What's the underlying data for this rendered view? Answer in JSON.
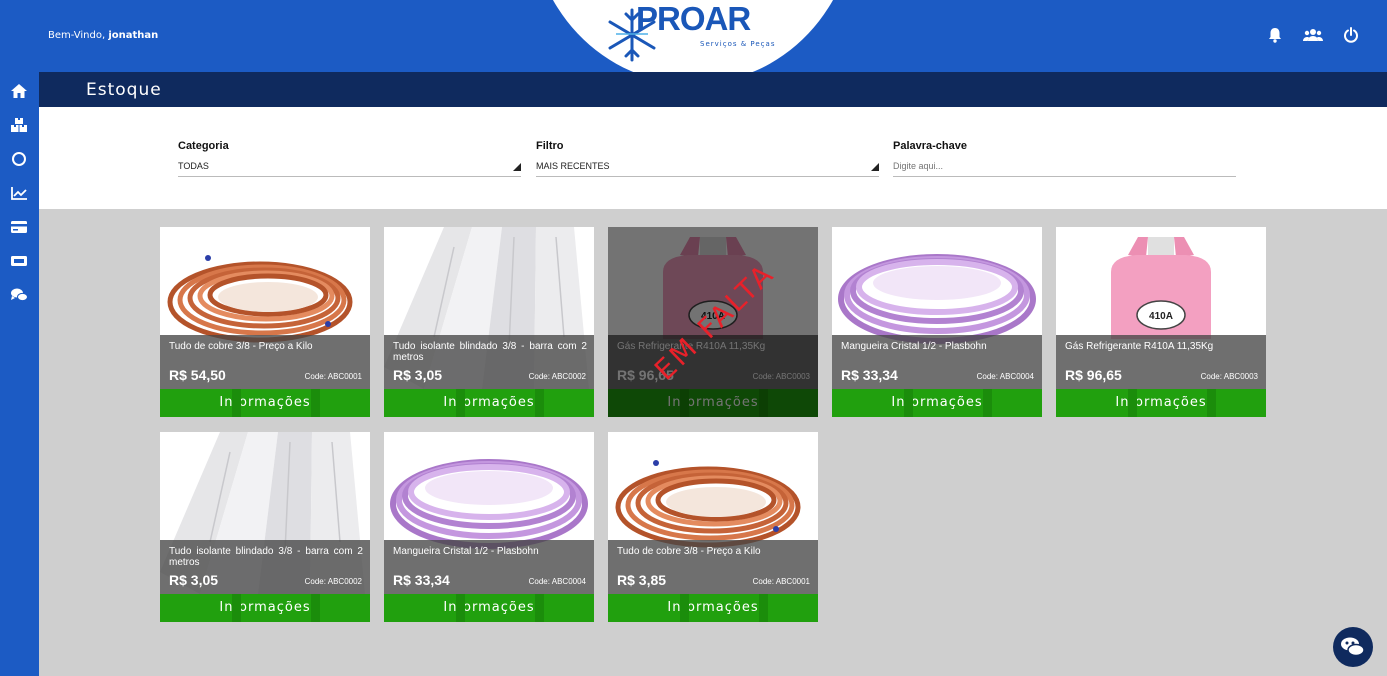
{
  "header": {
    "welcome_prefix": "Bem-Vindo,",
    "user_name": "jonathan",
    "logo_text": "PROAR",
    "logo_subtitle": "Serviços & Peças",
    "icons": [
      "bell-icon",
      "users-icon",
      "power-icon"
    ]
  },
  "sidebar": {
    "icons": [
      "home-icon",
      "boxes-icon",
      "circle-icon",
      "chart-icon",
      "card-icon",
      "ticket-icon",
      "chat-icon"
    ]
  },
  "page": {
    "title": "Estoque"
  },
  "filters": {
    "categoria": {
      "label": "Categoria",
      "value": "TODAS"
    },
    "filtro": {
      "label": "Filtro",
      "value": "MAIS RECENTES"
    },
    "palavra": {
      "label": "Palavra-chave",
      "placeholder": "Digite aqui..."
    }
  },
  "products": [
    {
      "name": "Tudo de cobre 3/8 - Preço a Kilo",
      "price": "R$ 54,50",
      "code": "Code: ABC0001",
      "button": "Informações",
      "image": "copper",
      "out_of_stock": false
    },
    {
      "name": "Tudo isolante blindado 3/8 - barra com 2 metros",
      "price": "R$ 3,05",
      "code": "Code: ABC0002",
      "button": "Informações",
      "image": "foam",
      "out_of_stock": false
    },
    {
      "name": "Gás Refrigerante R410A 11,35Kg",
      "price": "R$ 96,65",
      "code": "Code: ABC0003",
      "button": "Informações",
      "image": "gas",
      "out_of_stock": true,
      "stamp": "EM FALTA"
    },
    {
      "name": "Mangueira Cristal 1/2 - Plasbohn",
      "price": "R$ 33,34",
      "code": "Code: ABC0004",
      "button": "Informações",
      "image": "hose",
      "out_of_stock": false
    },
    {
      "name": "Gás Refrigerante R410A 11,35Kg",
      "price": "R$ 96,65",
      "code": "Code: ABC0003",
      "button": "Informações",
      "image": "gas",
      "out_of_stock": false
    },
    {
      "name": "Tudo isolante blindado 3/8 - barra com 2 metros",
      "price": "R$ 3,05",
      "code": "Code: ABC0002",
      "button": "Informações",
      "image": "foam",
      "out_of_stock": false
    },
    {
      "name": "Mangueira Cristal 1/2 - Plasbohn",
      "price": "R$ 33,34",
      "code": "Code: ABC0004",
      "button": "Informações",
      "image": "hose",
      "out_of_stock": false
    },
    {
      "name": "Tudo de cobre 3/8 - Preço a Kilo",
      "price": "R$ 3,85",
      "code": "Code: ABC0001",
      "button": "Informações",
      "image": "copper",
      "out_of_stock": false
    }
  ],
  "colors": {
    "primary": "#1c5bc4",
    "header_dark": "#0f2a5e",
    "button_green": "#21a00e",
    "stamp_red": "#e8212a"
  }
}
